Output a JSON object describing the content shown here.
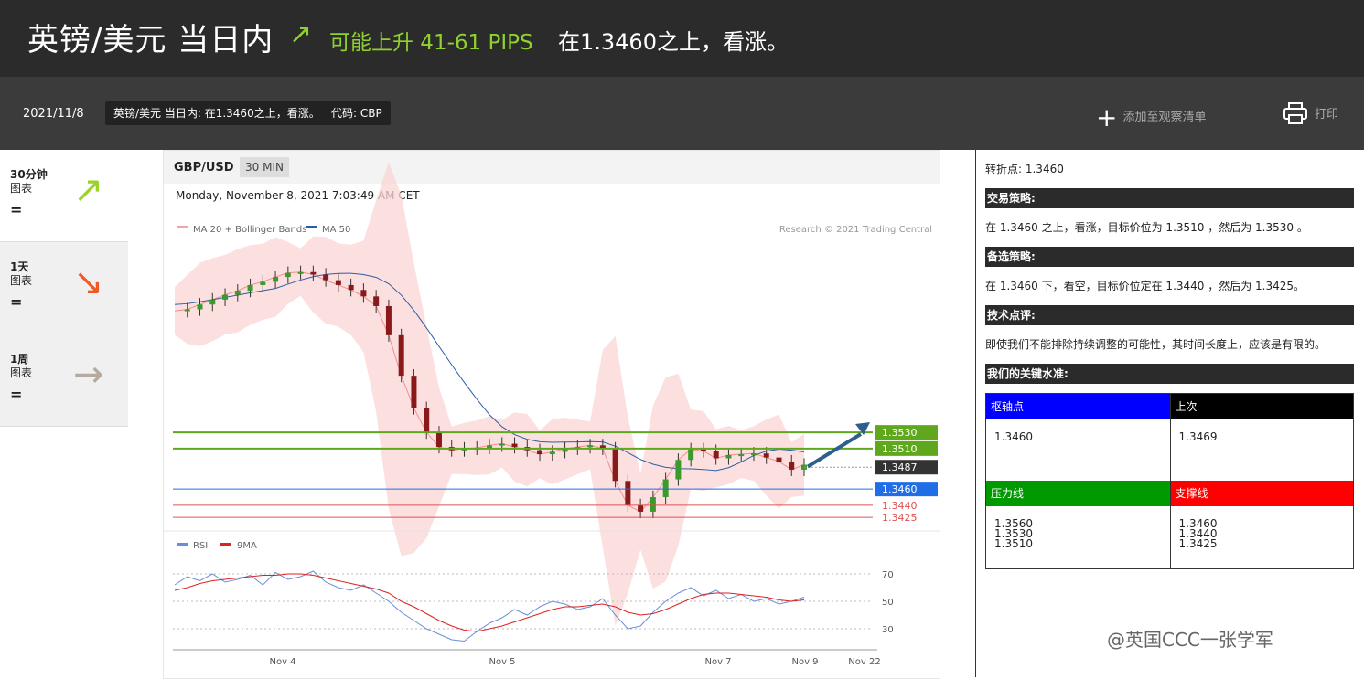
{
  "header": {
    "title": "英镑/美元 当日内",
    "arrow": "↗",
    "move": "可能上升 41-61 PIPS",
    "view": "在1.3460之上，看涨。"
  },
  "infobar": {
    "date": "2021/11/8",
    "summary": "英镑/美元 当日内: 在1.3460之上，看涨。",
    "code": "代码: CBP",
    "watch_icon": "+",
    "watch_label": "添加至观察清单",
    "print_label": "打印"
  },
  "sidebar": {
    "items": [
      {
        "period": "30分钟",
        "label": "图表",
        "sign": "=",
        "arrow": "↗",
        "color": "#9bd32a"
      },
      {
        "period": "1天",
        "label": "图表",
        "sign": "=",
        "arrow": "↘",
        "color": "#f05a28"
      },
      {
        "period": "1周",
        "label": "图表",
        "sign": "=",
        "arrow": "→",
        "color": "#b5aaa0"
      }
    ]
  },
  "chart": {
    "symbol": "GBP/USD",
    "timeframe": "30 MIN",
    "timestamp": "Monday, November 8, 2021 7:03:49 AM CET",
    "legend_ma20": "MA 20 + Bollinger Bands",
    "legend_ma50": "MA 50",
    "credit": "Research © 2021 Trading Central",
    "rsi_legend": "RSI",
    "rsi_ma_legend": "9MA"
  },
  "chart_data": {
    "type": "line",
    "title": "GBP/USD",
    "x_ticks": [
      "Nov 4",
      "Nov 5",
      "Nov 7",
      "Nov 9",
      "Nov 22"
    ],
    "ylim": [
      1.3415,
      1.3765
    ],
    "price_series": {
      "name": "MA 20 + Bollinger Bands",
      "values": [
        1.368,
        1.3682,
        1.3688,
        1.3694,
        1.37,
        1.3705,
        1.3712,
        1.3716,
        1.3722,
        1.3727,
        1.3728,
        1.3725,
        1.3718,
        1.3712,
        1.3706,
        1.3698,
        1.3686,
        1.365,
        1.36,
        1.356,
        1.353,
        1.3512,
        1.3508,
        1.351,
        1.3511,
        1.3514,
        1.3516,
        1.3512,
        1.3508,
        1.3503,
        1.3506,
        1.351,
        1.3512,
        1.3514,
        1.351,
        1.347,
        1.344,
        1.3432,
        1.345,
        1.3472,
        1.3496,
        1.3509,
        1.3507,
        1.3498,
        1.3502,
        1.3503,
        1.3504,
        1.3499,
        1.3494,
        1.3484,
        1.349
      ]
    },
    "levels": [
      {
        "value": 1.353,
        "label": "1.3530",
        "color": "#5fa81e"
      },
      {
        "value": 1.351,
        "label": "1.3510",
        "color": "#5fa81e"
      },
      {
        "value": 1.3487,
        "label": "1.3487",
        "color": "#333333"
      },
      {
        "value": 1.346,
        "label": "1.3460",
        "color": "#1f6ee8"
      },
      {
        "value": 1.344,
        "label": "1.3440",
        "color": "#e05050"
      },
      {
        "value": 1.3425,
        "label": "1.3425",
        "color": "#e05050"
      }
    ],
    "rsi": {
      "yticks": [
        70,
        50,
        30
      ],
      "rsi_values": [
        62,
        68,
        65,
        70,
        64,
        66,
        69,
        62,
        71,
        66,
        68,
        72,
        64,
        60,
        58,
        62,
        56,
        50,
        42,
        36,
        30,
        26,
        22,
        21,
        28,
        34,
        38,
        44,
        40,
        46,
        50,
        48,
        44,
        46,
        52,
        40,
        30,
        32,
        42,
        50,
        56,
        60,
        54,
        58,
        52,
        55,
        50,
        52,
        48,
        50,
        53
      ],
      "ma_values": [
        58,
        60,
        63,
        65,
        66,
        67,
        68,
        69,
        69,
        70,
        70,
        69,
        67,
        65,
        63,
        61,
        59,
        56,
        50,
        46,
        41,
        36,
        32,
        29,
        28,
        30,
        32,
        35,
        38,
        41,
        44,
        46,
        46,
        47,
        48,
        46,
        42,
        40,
        41,
        44,
        48,
        52,
        55,
        56,
        56,
        55,
        54,
        53,
        51,
        50,
        51
      ]
    }
  },
  "panel": {
    "pivot_line": "转折点: 1.3460",
    "h1": "交易策略:",
    "t1": "在 1.3460 之上，看涨，目标价位为 1.3510 ，然后为 1.3530 。",
    "h2": "备选策略:",
    "t2": "在 1.3460 下，看空，目标价位定在 1.3440 ，然后为 1.3425。",
    "h3": "技术点评:",
    "t3": "即使我们不能排除持续调整的可能性，其时间长度上，应该是有限的。",
    "h4": "我们的关键水准:",
    "table": {
      "pivot_h": "枢轴点",
      "last_h": "上次",
      "pivot_v": "1.3460",
      "last_v": "1.3469",
      "res_h": "压力线",
      "sup_h": "支撑线",
      "res": [
        "1.3560",
        "1.3530",
        "1.3510"
      ],
      "sup": [
        "1.3460",
        "1.3440",
        "1.3425"
      ],
      "colors": {
        "pivot": "#0000ff",
        "last": "#000000",
        "res": "#009900",
        "sup": "#ff0000"
      }
    }
  },
  "watermark": "@英国CCC一张学军"
}
